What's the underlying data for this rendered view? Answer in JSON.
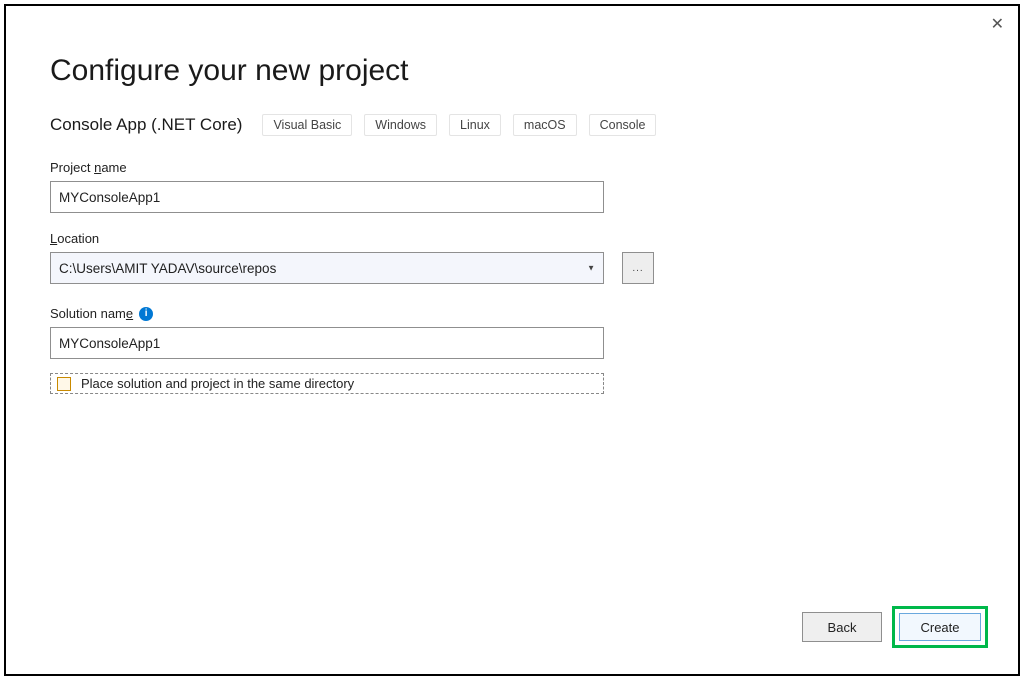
{
  "close_glyph": "✕",
  "title": "Configure your new project",
  "subtitle": "Console App (.NET Core)",
  "tags": [
    "Visual Basic",
    "Windows",
    "Linux",
    "macOS",
    "Console"
  ],
  "project_name": {
    "label_prefix": "Project ",
    "label_underlined": "n",
    "label_suffix": "ame",
    "value": "MYConsoleApp1"
  },
  "location": {
    "label_underlined": "L",
    "label_suffix": "ocation",
    "value": "C:\\Users\\AMIT YADAV\\source\\repos",
    "browse_label": "..."
  },
  "solution_name": {
    "label_prefix": "Solution nam",
    "label_underlined": "e",
    "info_glyph": "i",
    "value": "MYConsoleApp1"
  },
  "checkbox": {
    "label_prefix": "Place solution and project in the same ",
    "label_underlined": "d",
    "label_suffix": "irectory"
  },
  "buttons": {
    "back_underlined": "B",
    "back_suffix": "ack",
    "create_underlined": "C",
    "create_suffix": "reate"
  }
}
